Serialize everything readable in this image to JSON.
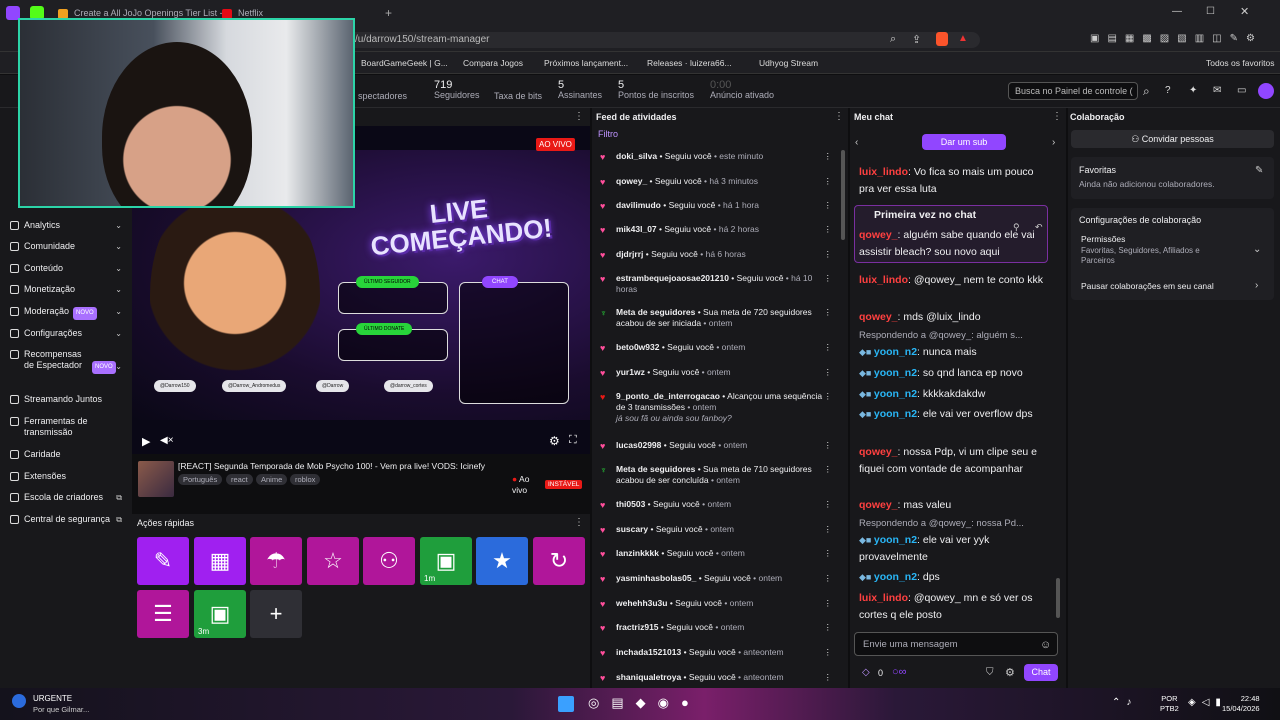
{
  "browser": {
    "tabs": [
      {
        "label": "Create a All JoJo Openings Tier List -",
        "color": "#f0a020"
      },
      {
        "label": "Netflix",
        "color": "#e50914"
      }
    ],
    "url": "v/u/darrow150/stream-manager",
    "bookmarks": [
      "BoardGameGeek | G...",
      "Compara Jogos",
      "Próximos lançament...",
      "Releases · luizera66...",
      "Udhyog Stream"
    ],
    "all_favorites": "Todos os favoritos"
  },
  "topbar": {
    "stats": [
      {
        "value": "",
        "label": "spectadores"
      },
      {
        "value": "719",
        "label": "Seguidores"
      },
      {
        "value": "",
        "label": "Taxa de bits"
      },
      {
        "value": "5",
        "label": "Assinantes"
      },
      {
        "value": "5",
        "label": "Pontos de inscritos"
      },
      {
        "value": "0:00",
        "label": "Anúncio ativado"
      }
    ],
    "search_placeholder": "Busca no Painel de controle (",
    "accent": "#9146ff"
  },
  "sidebar": {
    "items": [
      {
        "label": "Analytics"
      },
      {
        "label": "Comunidade"
      },
      {
        "label": "Conteúdo"
      },
      {
        "label": "Monetização"
      },
      {
        "label": "Moderação",
        "badge": "NOVO"
      },
      {
        "label": "Configurações"
      },
      {
        "label": "Recompensas de Espectador",
        "badge": "NOVO"
      },
      {
        "label": "Streamando Juntos"
      },
      {
        "label": "Ferramentas de transmissão"
      },
      {
        "label": "Caridade"
      },
      {
        "label": "Extensões"
      },
      {
        "label": "Escola de criadores"
      },
      {
        "label": "Central de segurança"
      }
    ]
  },
  "video": {
    "live_badge": "AO VIVO",
    "overlay_title_1": "LIVE",
    "overlay_title_2": "COMEÇANDO!",
    "last_follower": "ÚLTIMO SEGUIDOR",
    "last_donate": "ÚLTIMO DONATE",
    "chat_label": "CHAT",
    "socials": [
      "@Darrow150",
      "@Darrow_Andromedus",
      "@Darrow",
      "@darrow_cortes"
    ]
  },
  "stream": {
    "title": "[REACT] Segunda Temporada de Mob Psycho 100! - Vem pra live! VODS: Icinefy",
    "tags": [
      "Português",
      "react",
      "Anime",
      "roblox"
    ],
    "status": "Ao vivo",
    "unstable": "INSTÁVEL"
  },
  "quick_actions": {
    "header": "Ações rápidas",
    "buttons": [
      {
        "icon": "pencil-icon",
        "glyph": "✎",
        "color": "#a020f0",
        "sub": ""
      },
      {
        "icon": "clapper-icon",
        "glyph": "▦",
        "color": "#a020f0",
        "sub": ""
      },
      {
        "icon": "parachute-icon",
        "glyph": "☂",
        "color": "#b0169a",
        "sub": ""
      },
      {
        "icon": "star-outline-icon",
        "glyph": "☆",
        "color": "#b0169a",
        "sub": ""
      },
      {
        "icon": "add-user-icon",
        "glyph": "⚇",
        "color": "#b0169a",
        "sub": ""
      },
      {
        "icon": "ad-icon",
        "glyph": "▣",
        "color": "#1f9e3c",
        "sub": "1m"
      },
      {
        "icon": "star-icon",
        "glyph": "★",
        "color": "#2b6bdc",
        "sub": ""
      },
      {
        "icon": "replay-icon",
        "glyph": "↻",
        "color": "#b0169a",
        "sub": ""
      },
      {
        "icon": "layout-icon",
        "glyph": "☰",
        "color": "#b0169a",
        "sub": ""
      },
      {
        "icon": "ad-icon",
        "glyph": "▣",
        "color": "#1f9e3c",
        "sub": "3m"
      },
      {
        "icon": "plus-icon",
        "glyph": "+",
        "color": "#2f2f35",
        "sub": ""
      }
    ]
  },
  "feed": {
    "header": "Feed de atividades",
    "filter": "Filtro",
    "items": [
      {
        "kind": "follow",
        "user": "doki_silva",
        "action": " • Seguiu você",
        "time": " • este minuto"
      },
      {
        "kind": "follow",
        "user": "qowey_",
        "action": " • Seguiu você",
        "time": " • há 3 minutos"
      },
      {
        "kind": "follow",
        "user": "davilimudo",
        "action": " • Seguiu você",
        "time": " • há 1 hora"
      },
      {
        "kind": "follow",
        "user": "mik43l_07",
        "action": " • Seguiu você",
        "time": " • há 2 horas"
      },
      {
        "kind": "follow",
        "user": "djdrjrrj",
        "action": " • Seguiu você",
        "time": " • há 6 horas"
      },
      {
        "kind": "follow",
        "user": "estrambequejoaosae201210",
        "action": " • Seguiu você",
        "time": " • há 10 horas"
      },
      {
        "kind": "goal",
        "user": "Meta de seguidores",
        "action": " • Sua meta de 720 seguidores acabou de ser iniciada",
        "time": " • ontem"
      },
      {
        "kind": "follow",
        "user": "beto0w932",
        "action": " • Seguiu você",
        "time": " • ontem"
      },
      {
        "kind": "follow",
        "user": "yur1wz",
        "action": " • Seguiu você",
        "time": " • ontem"
      },
      {
        "kind": "sub",
        "user": "9_ponto_de_interrogacao",
        "action": " • Alcançou uma sequência de 3 transmissões",
        "time": " • ontem",
        "extra": "já sou fã ou ainda sou fanboy?"
      },
      {
        "kind": "follow",
        "user": "lucas02998",
        "action": " • Seguiu você",
        "time": " • ontem"
      },
      {
        "kind": "goal",
        "user": "Meta de seguidores",
        "action": " • Sua meta de 710 seguidores acabou de ser concluída",
        "time": " • ontem"
      },
      {
        "kind": "follow",
        "user": "thi0503",
        "action": " • Seguiu você",
        "time": " • ontem"
      },
      {
        "kind": "follow",
        "user": "suscary",
        "action": " • Seguiu você",
        "time": " • ontem"
      },
      {
        "kind": "follow",
        "user": "lanzinkkkk",
        "action": " • Seguiu você",
        "time": " • ontem"
      },
      {
        "kind": "follow",
        "user": "yasminhasbolas05_",
        "action": " • Seguiu você",
        "time": " • ontem"
      },
      {
        "kind": "follow",
        "user": "wehehh3u3u",
        "action": " • Seguiu você",
        "time": " • ontem"
      },
      {
        "kind": "follow",
        "user": "fractriz915",
        "action": " • Seguiu você",
        "time": " • ontem"
      },
      {
        "kind": "follow",
        "user": "inchada1521013",
        "action": " • Seguiu você",
        "time": " • anteontem"
      },
      {
        "kind": "follow",
        "user": "shaniqualetroya",
        "action": " • Seguiu você",
        "time": " • anteontem"
      }
    ]
  },
  "chat": {
    "header": "Meu chat",
    "sub_button": "Dar um sub",
    "first_time": "Primeira vez no chat",
    "messages": [
      {
        "user": "luix_lindo",
        "color": "#ff4040",
        "text": ": Vo fica so mais um pouco pra ver essa luta"
      },
      {
        "user": "qowey_",
        "color": "#ff4040",
        "text": ": alguém sabe quando ele vai assistir bleach? sou novo aqui"
      },
      {
        "user": "luix_lindo",
        "color": "#ff4040",
        "text": ": @qowey_ nem te conto kkk"
      },
      {
        "user": "qowey_",
        "color": "#ff4040",
        "text": ": mds @luix_lindo"
      },
      {
        "reply": "Respondendo a @qowey_: alguém s..."
      },
      {
        "user": "yoon_n2",
        "color": "#29b6f6",
        "text": ": nunca mais"
      },
      {
        "user": "yoon_n2",
        "color": "#29b6f6",
        "text": ": so qnd lanca ep novo"
      },
      {
        "user": "yoon_n2",
        "color": "#29b6f6",
        "text": ": kkkkakdakdw"
      },
      {
        "user": "yoon_n2",
        "color": "#29b6f6",
        "text": ": ele vai ver overflow dps"
      },
      {
        "user": "qowey_",
        "color": "#ff4040",
        "text": ": nossa Pdp, vi um clipe seu e fiquei com vontade de acompanhar"
      },
      {
        "user": "qowey_",
        "color": "#ff4040",
        "text": ": mas valeu"
      },
      {
        "reply": "Respondendo a @qowey_: nossa Pd..."
      },
      {
        "user": "yoon_n2",
        "color": "#29b6f6",
        "text": ": ele vai ver yyk provavelmente"
      },
      {
        "user": "yoon_n2",
        "color": "#29b6f6",
        "text": ": dps"
      },
      {
        "user": "luix_lindo",
        "color": "#ff4040",
        "text": ": @qowey_ mn e só ver os cortes q ele posto"
      }
    ],
    "input_placeholder": "Envie uma mensagem",
    "points": "0",
    "send_label": "Chat"
  },
  "collab": {
    "header": "Colaboração",
    "invite": "Convidar pessoas",
    "favorites_title": "Favoritas",
    "favorites_empty": "Ainda não adicionou colaboradores.",
    "settings_title": "Configurações de colaboração",
    "permissions_title": "Permissões",
    "permissions_value": "Favoritas, Seguidores, Afiliados e Parceiros",
    "pause": "Pausar colaborações em seu canal"
  },
  "taskbar": {
    "notice_title": "URGENTE",
    "notice_sub": "Por que Gilmar...",
    "lang": "POR",
    "layout": "PTB2",
    "time": "22:48",
    "date": "15/04/2026"
  }
}
